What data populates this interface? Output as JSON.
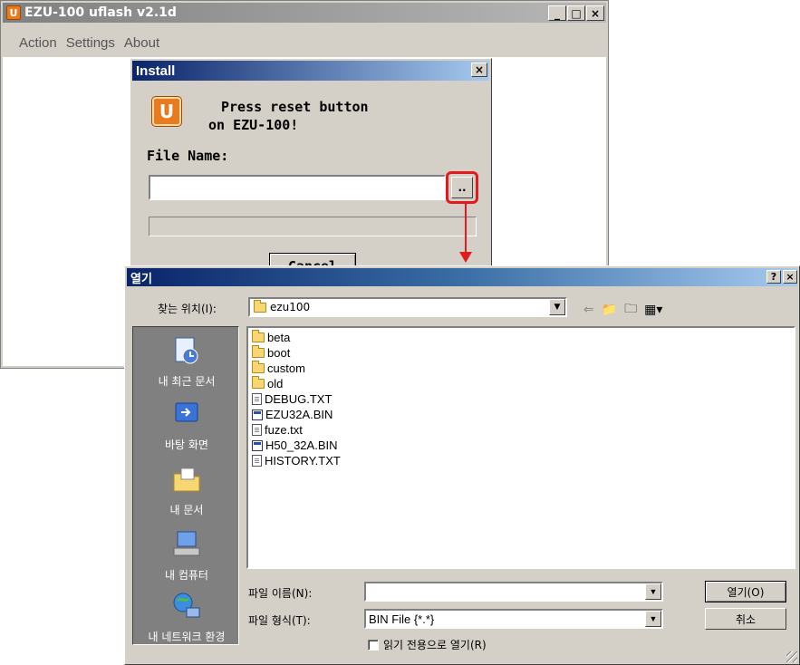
{
  "main_window": {
    "title": "EZU-100 uflash v2.1d",
    "menu": [
      "Action",
      "Settings",
      "About"
    ],
    "min_label": "_",
    "max_label": "□",
    "close_label": "×"
  },
  "install_dialog": {
    "title": "Install",
    "close_label": "×",
    "icon_letter": "U",
    "message_line1": "Press reset button",
    "message_line2": "on EZU-100!",
    "file_name_label": "File Name:",
    "file_name_value": "",
    "browse_label": "..",
    "cancel_label": "Cancel"
  },
  "open_dialog": {
    "title": "열기",
    "help_label": "?",
    "close_label": "×",
    "look_in_label": "찾는 위치(I):",
    "look_in_value": "ezu100",
    "places": [
      "내 최근 문서",
      "바탕 화면",
      "내 문서",
      "내 컴퓨터",
      "내 네트워크 환경"
    ],
    "files": [
      {
        "name": "beta",
        "type": "folder"
      },
      {
        "name": "boot",
        "type": "folder"
      },
      {
        "name": "custom",
        "type": "folder"
      },
      {
        "name": "old",
        "type": "folder"
      },
      {
        "name": "DEBUG.TXT",
        "type": "txt"
      },
      {
        "name": "EZU32A.BIN",
        "type": "bin"
      },
      {
        "name": "fuze.txt",
        "type": "txt"
      },
      {
        "name": "H50_32A.BIN",
        "type": "bin"
      },
      {
        "name": "HISTORY.TXT",
        "type": "txt"
      }
    ],
    "file_name_label": "파일 이름(N):",
    "file_name_value": "",
    "file_type_label": "파일 형식(T):",
    "file_type_value": "BIN File {*.*}",
    "readonly_label": "읽기 전용으로 열기(R)",
    "open_button": "열기(O)",
    "cancel_button": "취소"
  },
  "colors": {
    "highlight": "#e21b1b",
    "active_title": "#0a246a",
    "app_icon": "#e87b1e"
  }
}
